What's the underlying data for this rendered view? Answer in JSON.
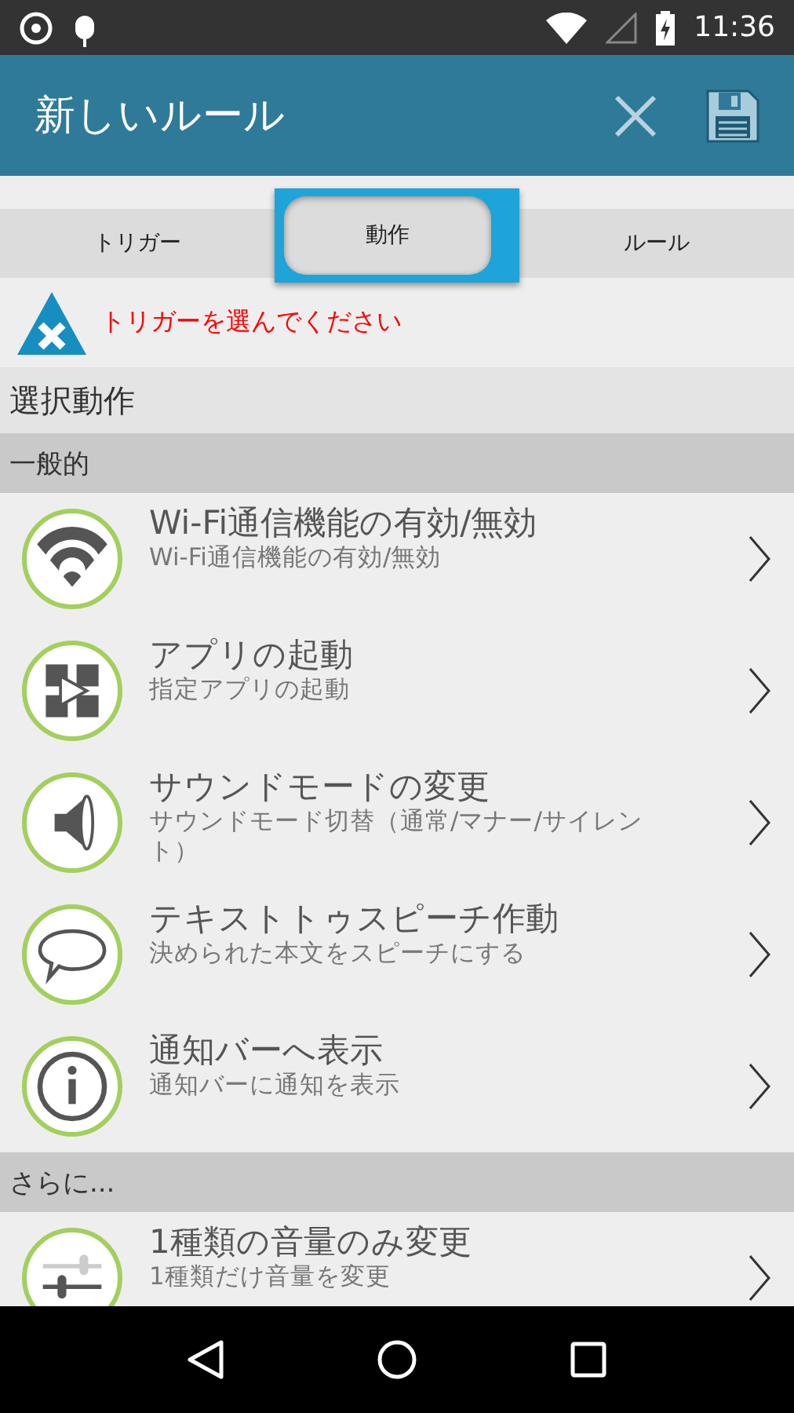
{
  "status_bar": {
    "time": "11:36"
  },
  "app_bar": {
    "title": "新しいルール"
  },
  "tabs": [
    {
      "label": "トリガー",
      "selected": false
    },
    {
      "label": "動作",
      "selected": true
    },
    {
      "label": "ルール",
      "selected": false
    }
  ],
  "warning": {
    "text": "トリガーを選んでください"
  },
  "heading": "選択動作",
  "sections": [
    {
      "title": "一般的",
      "items": [
        {
          "kind": "wifi",
          "title": "Wi-Fi通信機能の有効/無効",
          "subtitle": "Wi-Fi通信機能の有効/無効"
        },
        {
          "kind": "app",
          "title": "アプリの起動",
          "subtitle": "指定アプリの起動"
        },
        {
          "kind": "sound",
          "title": "サウンドモードの変更",
          "subtitle": "サウンドモード切替（通常/マナー/サイレント）"
        },
        {
          "kind": "speech",
          "title": "テキストトゥスピーチ作動",
          "subtitle": "決められた本文をスピーチにする"
        },
        {
          "kind": "info",
          "title": "通知バーへ表示",
          "subtitle": "通知バーに通知を表示"
        }
      ]
    },
    {
      "title": "さらに...",
      "items": [
        {
          "kind": "sliders",
          "title": "1種類の音量のみ変更",
          "subtitle": "1種類だけ音量を変更"
        }
      ]
    }
  ]
}
